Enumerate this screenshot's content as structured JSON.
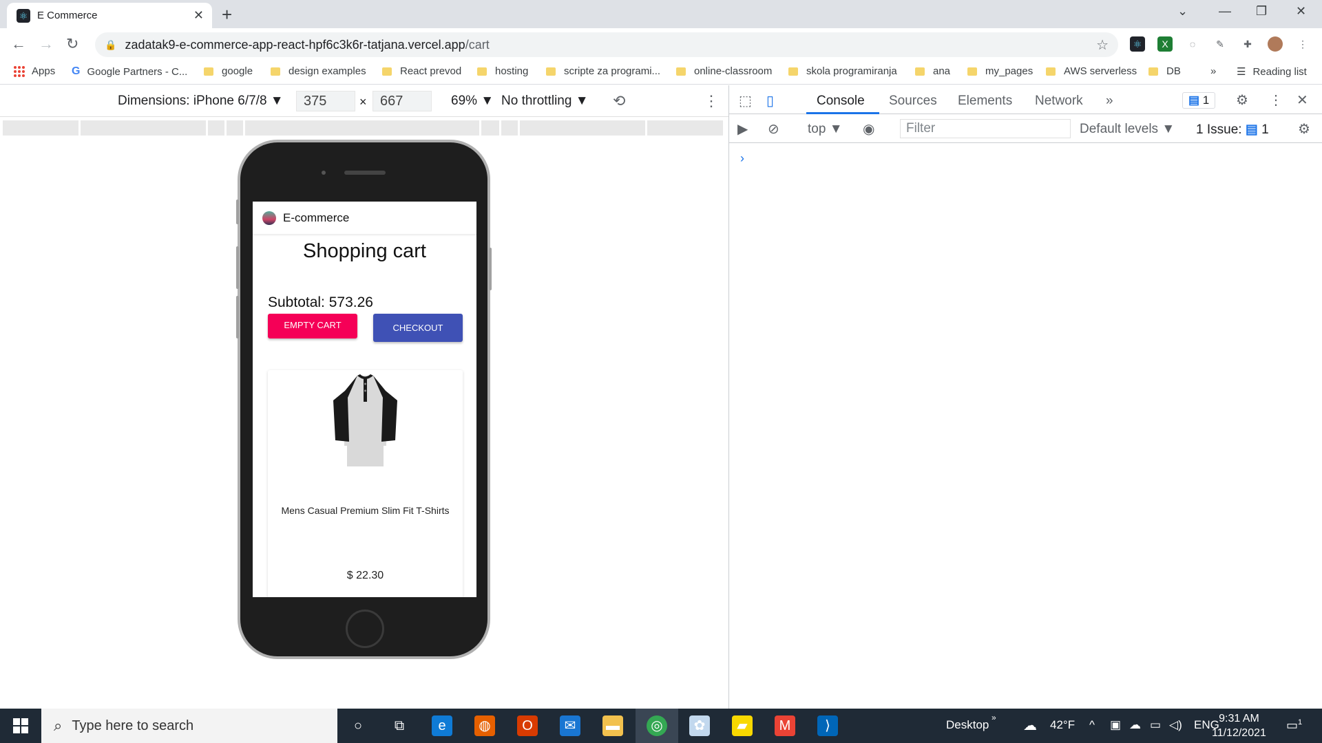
{
  "browser": {
    "tab_title": "E Commerce",
    "tab_favicon": "react-icon",
    "url_host": "zadatak9-e-commerce-app-react-hpf6c3k6r-tatjana.vercel.app",
    "url_path": "/cart"
  },
  "bookmarks": [
    {
      "label": "Apps",
      "icon": "apps-grid-icon"
    },
    {
      "label": "Google Partners - C...",
      "icon": "google-icon"
    },
    {
      "label": "google",
      "icon": "folder-icon"
    },
    {
      "label": "design examples",
      "icon": "folder-icon"
    },
    {
      "label": "React prevod",
      "icon": "folder-icon"
    },
    {
      "label": "hosting",
      "icon": "folder-icon"
    },
    {
      "label": "scripte za programi...",
      "icon": "folder-icon"
    },
    {
      "label": "online-classroom",
      "icon": "folder-icon"
    },
    {
      "label": "skola programiranja",
      "icon": "folder-icon"
    },
    {
      "label": "ana",
      "icon": "folder-icon"
    },
    {
      "label": "my_pages",
      "icon": "folder-icon"
    },
    {
      "label": "AWS serverless",
      "icon": "folder-icon"
    },
    {
      "label": "DB",
      "icon": "folder-icon"
    }
  ],
  "bookmarks_overflow": "»",
  "reading_list": "Reading list",
  "device_toolbar": {
    "dimensions": "Dimensions: iPhone 6/7/8",
    "width": "375",
    "height": "667",
    "times": "×",
    "zoom": "69%",
    "throttling": "No throttling"
  },
  "app": {
    "brand": "E-commerce",
    "heading": "Shopping cart",
    "subtotal": "Subtotal: 573.26",
    "empty_cart": "EMPTY CART",
    "checkout": "CHECKOUT",
    "product_name": "Mens Casual Premium Slim Fit T-Shirts",
    "product_price": "$ 22.30",
    "colors": {
      "empty_cart": "#f50057",
      "checkout": "#3f51b5"
    }
  },
  "devtools": {
    "tabs": [
      "Console",
      "Sources",
      "Elements",
      "Network"
    ],
    "more_tabs": "»",
    "messages_badge": "1",
    "context": "top",
    "filter_placeholder": "Filter",
    "levels": "Default levels",
    "issues_label": "1 Issue:",
    "issues_count": "1",
    "prompt": "›"
  },
  "taskbar": {
    "search_placeholder": "Type here to search",
    "desktop": "Desktop",
    "temperature": "42°F",
    "language": "ENG",
    "time": "9:31 AM",
    "date": "11/12/2021",
    "notifications": "1"
  }
}
